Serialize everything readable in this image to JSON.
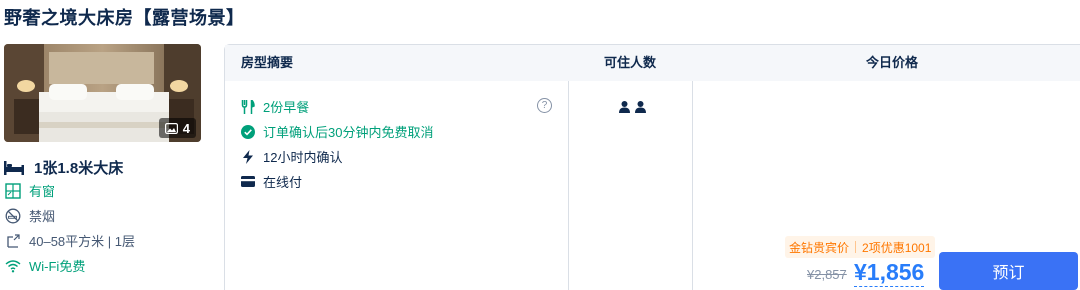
{
  "room": {
    "title": "野奢之境大床房【露营场景】",
    "photo_count": "4",
    "bed": "1张1.8米大床",
    "window": "有窗",
    "smoking": "禁烟",
    "area": "40–58平方米 | 1层",
    "wifi": "Wi-Fi免费"
  },
  "table": {
    "headers": {
      "summary": "房型摘要",
      "occupancy": "可住人数",
      "price": "今日价格"
    },
    "features": {
      "breakfast": "2份早餐",
      "cancel": "订单确认后30分钟内免费取消",
      "confirm": "12小时内确认",
      "payment": "在线付"
    },
    "occupancy_count": 2
  },
  "price": {
    "member": "金钻贵宾价",
    "promo": "2项优惠1001",
    "original": "¥2,857",
    "current": "¥1,856",
    "book_label": "预订"
  },
  "colors": {
    "primary_blue": "#287dfa",
    "button_blue": "#3a72f5",
    "green": "#00a07a",
    "promo_orange": "#ff7700"
  }
}
